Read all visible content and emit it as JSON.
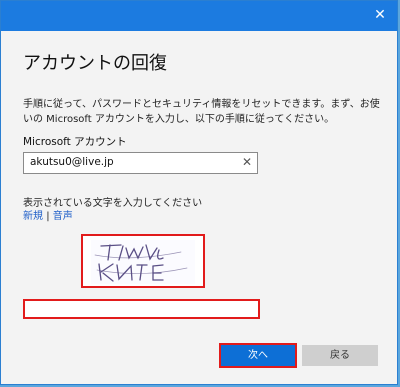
{
  "window": {
    "close_icon": "close-icon"
  },
  "heading": "アカウントの回復",
  "description": "手順に従って、パスワードとセキュリティ情報をリセットできます。まず、お使いの Microsoft アカウントを入力し、以下の手順に従ってください。",
  "account": {
    "label": "Microsoft アカウント",
    "email_value": "akutsu0@live.jp",
    "clear_icon": "close-icon"
  },
  "captcha": {
    "prompt": "表示されている文字を入力してください",
    "link_new": "新規",
    "separator": "|",
    "link_audio": "音声",
    "input_value": ""
  },
  "buttons": {
    "next": "次へ",
    "back": "戻る"
  },
  "colors": {
    "title_bar": "#1c7be0",
    "primary_button": "#0d6fd6",
    "highlight_border": "#e21b1b",
    "link": "#1f5fc9"
  }
}
